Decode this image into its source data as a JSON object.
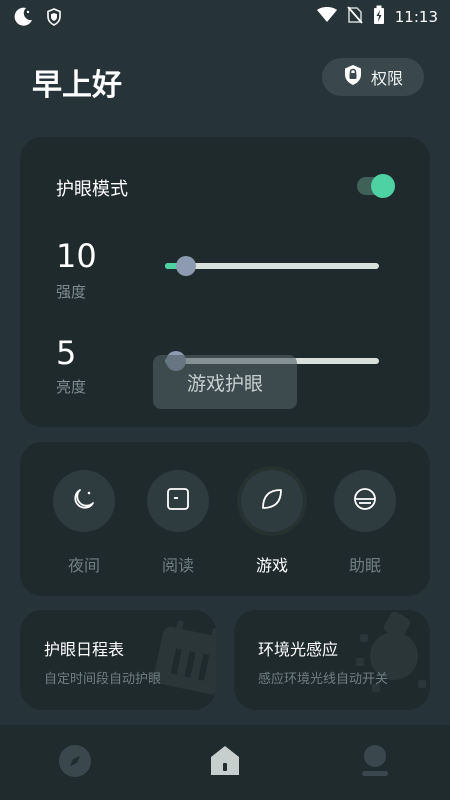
{
  "status_bar": {
    "time": "11:13",
    "icons": [
      "moon-icon",
      "shield-icon",
      "wifi-icon",
      "no-sim-icon",
      "battery-charging-icon"
    ]
  },
  "header": {
    "greeting": "早上好",
    "permission_button": {
      "label": "权限",
      "icon": "shield-icon"
    }
  },
  "eye_care": {
    "title": "护眼模式",
    "enabled": true,
    "intensity": {
      "value": "10",
      "label": "强度",
      "level_fraction": 0.1
    },
    "brightness": {
      "value": "5",
      "label": "亮度",
      "level_fraction": 0.05
    }
  },
  "toast": "游戏护眼",
  "scenes": [
    {
      "label": "夜间",
      "icon": "moon-icon",
      "active": false
    },
    {
      "label": "阅读",
      "icon": "book-icon",
      "active": false
    },
    {
      "label": "游戏",
      "icon": "leaf-icon",
      "active": true
    },
    {
      "label": "助眠",
      "icon": "sleep-icon",
      "active": false
    }
  ],
  "features": [
    {
      "title": "护眼日程表",
      "subtitle": "自定时间段自动护眼",
      "icon": "calendar-icon"
    },
    {
      "title": "环境光感应",
      "subtitle": "感应环境光线自动开关",
      "icon": "light-sensor-icon"
    }
  ],
  "bottom_nav": [
    {
      "icon": "compass-icon",
      "active": false
    },
    {
      "icon": "home-icon",
      "active": true
    },
    {
      "icon": "profile-icon",
      "active": false
    }
  ],
  "colors": {
    "background": "#263338",
    "card": "#1f2a2d",
    "accent": "#4ed2a3",
    "thumb": "#8c9ab2",
    "muted_text": "#6f7e82"
  }
}
